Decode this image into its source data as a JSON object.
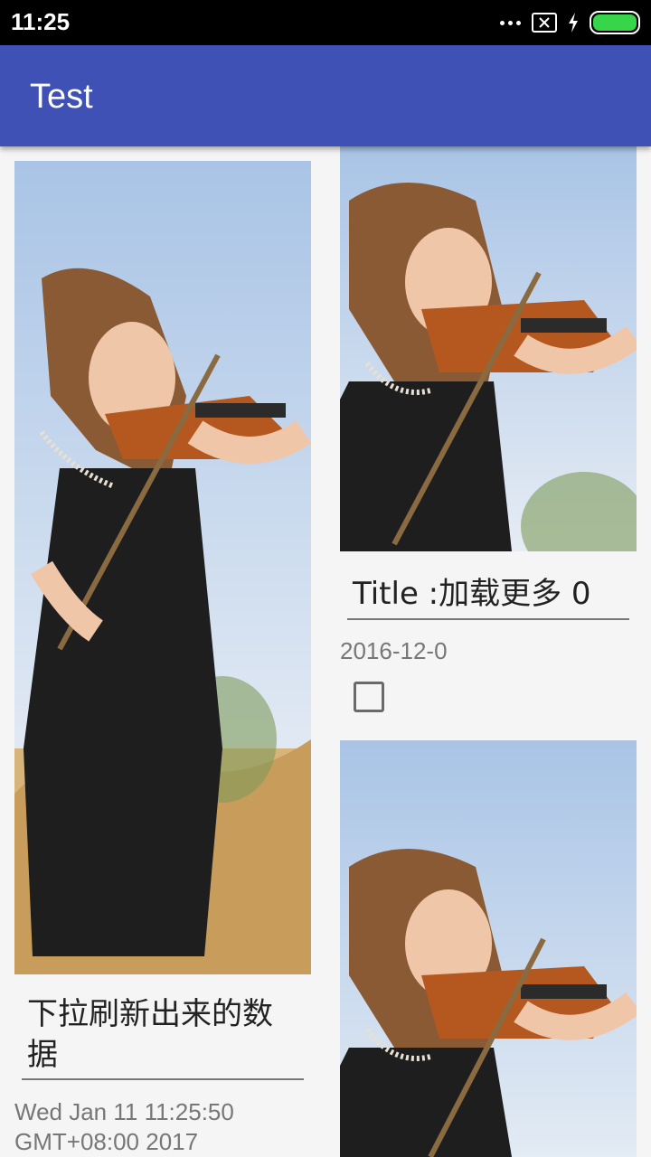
{
  "status_bar": {
    "time": "11:25",
    "icons": [
      "more-dots-icon",
      "sim-off-icon",
      "charging-icon",
      "battery-icon"
    ],
    "battery_color": "#37d64a"
  },
  "app_bar": {
    "title": "Test",
    "color": "#3f51b5"
  },
  "feed": {
    "left_column": [
      {
        "image": "violinist-photo",
        "title": "下拉刷新出来的数据",
        "date": "Wed Jan 11 11:25:50 GMT+08:00 2017"
      }
    ],
    "right_column": [
      {
        "image": "violinist-photo",
        "title": "Title :加载更多 0",
        "date": "2016-12-0",
        "checked": false
      },
      {
        "image": "violinist-photo"
      }
    ]
  }
}
